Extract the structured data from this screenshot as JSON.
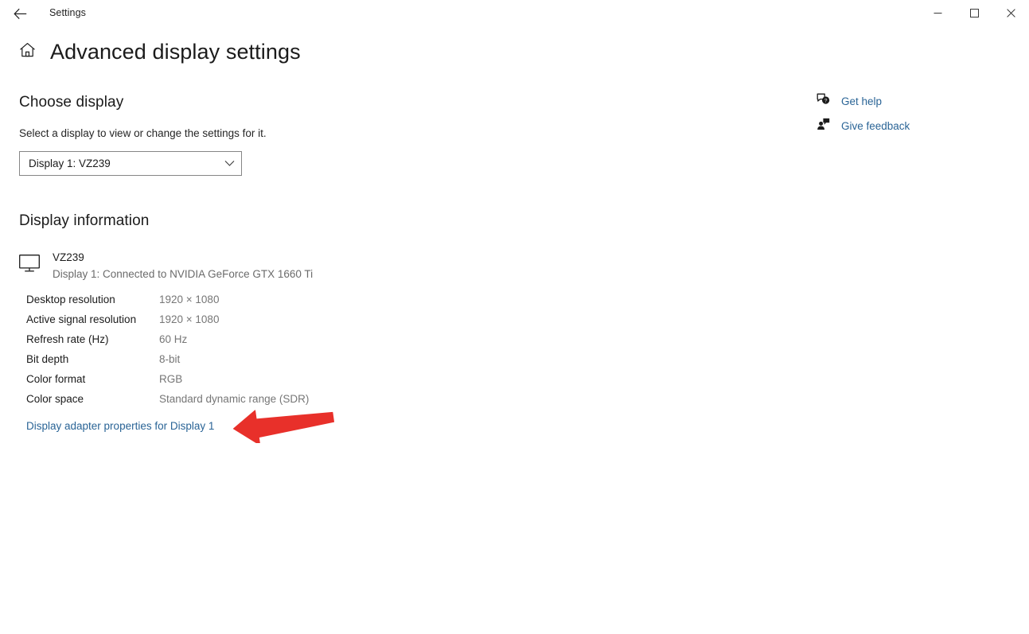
{
  "titlebar": {
    "back_icon": "back-arrow-icon",
    "app_title": "Settings",
    "minimize_label": "─",
    "maximize_label": "□",
    "close_label": "✕"
  },
  "header": {
    "home_icon": "home-icon",
    "title": "Advanced display settings"
  },
  "choose_display": {
    "heading": "Choose display",
    "description": "Select a display to view or change the settings for it.",
    "dropdown": {
      "selected": "Display 1: VZ239",
      "chevron_icon": "chevron-down-icon",
      "options": [
        "Display 1: VZ239"
      ]
    }
  },
  "display_information": {
    "heading": "Display information",
    "monitor_icon": "monitor-icon",
    "monitor_name": "VZ239",
    "connection": "Display 1: Connected to NVIDIA GeForce GTX 1660 Ti",
    "specs": [
      {
        "label": "Desktop resolution",
        "value": "1920 × 1080"
      },
      {
        "label": "Active signal resolution",
        "value": "1920 × 1080"
      },
      {
        "label": "Refresh rate (Hz)",
        "value": "60 Hz"
      },
      {
        "label": "Bit depth",
        "value": "8-bit"
      },
      {
        "label": "Color format",
        "value": "RGB"
      },
      {
        "label": "Color space",
        "value": "Standard dynamic range (SDR)"
      }
    ],
    "adapter_link": "Display adapter properties for Display 1"
  },
  "right_rail": {
    "items": [
      {
        "label": "Get help",
        "icon": "help-bubble-icon"
      },
      {
        "label": "Give feedback",
        "icon": "feedback-person-icon"
      }
    ]
  },
  "annotation": {
    "arrow_icon": "red-arrow-pointing-left",
    "color": "#E8302A"
  },
  "colors": {
    "link": "#2a6496",
    "value_text": "#767676",
    "background": "#ffffff",
    "annotation_red": "#E8302A"
  }
}
